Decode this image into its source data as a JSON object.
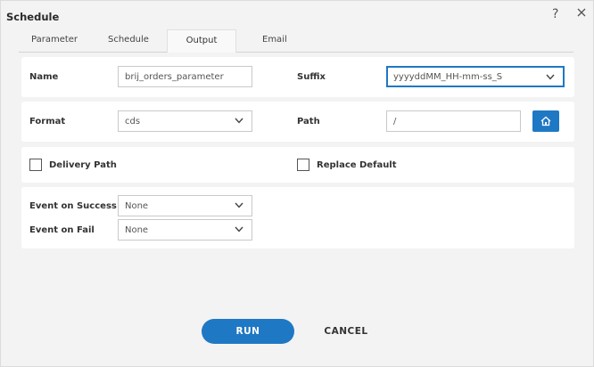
{
  "dialog": {
    "title": "Schedule",
    "help_icon": "question-mark-icon",
    "close_icon": "close-icon"
  },
  "tabs": [
    {
      "label": "Parameter",
      "active": false
    },
    {
      "label": "Schedule",
      "active": false
    },
    {
      "label": "Output",
      "active": true
    },
    {
      "label": "Email",
      "active": false
    }
  ],
  "output": {
    "name": {
      "label": "Name",
      "value": "brij_orders_parameter"
    },
    "suffix": {
      "label": "Suffix",
      "value": "yyyyddMM_HH-mm-ss_S"
    },
    "format": {
      "label": "Format",
      "value": "cds"
    },
    "path": {
      "label": "Path",
      "value": "/",
      "button_icon": "home-icon"
    },
    "delivery_path": {
      "label": "Delivery Path",
      "checked": false
    },
    "replace_default": {
      "label": "Replace Default",
      "checked": false
    },
    "event_on_success": {
      "label": "Event on Success",
      "value": "None"
    },
    "event_on_fail": {
      "label": "Event on Fail",
      "value": "None"
    }
  },
  "actions": {
    "run_label": "RUN",
    "cancel_label": "CANCEL"
  },
  "colors": {
    "accent": "#1f78c4",
    "background": "#f3f3f3",
    "card": "#ffffff"
  }
}
